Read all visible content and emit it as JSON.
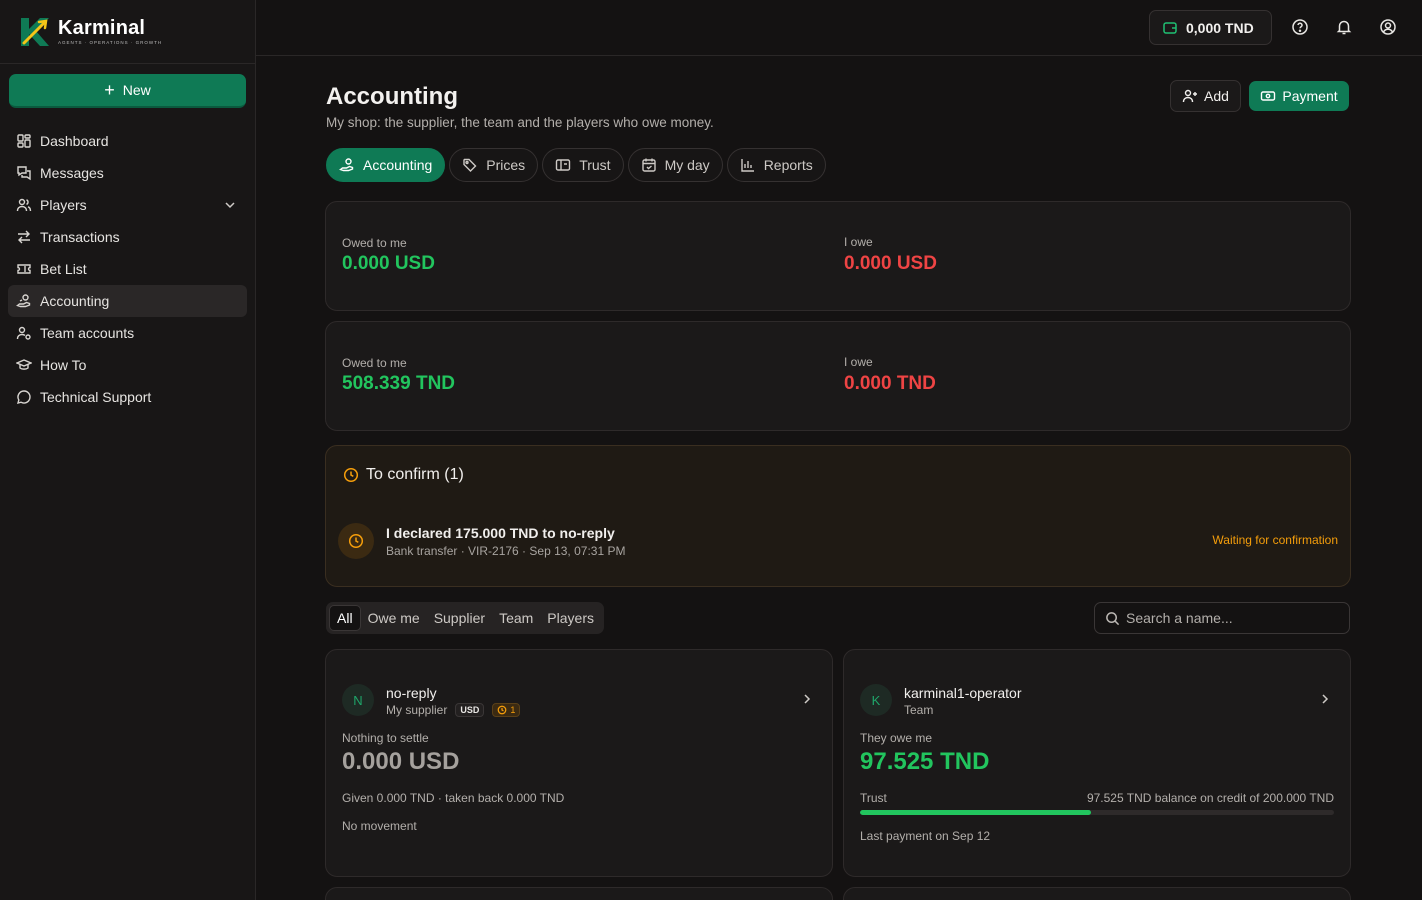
{
  "brand": {
    "name": "Karminal",
    "tagline": "AGENTS · OPERATIONS · GROWTH"
  },
  "sidebar": {
    "new_label": "New",
    "items": [
      {
        "label": "Dashboard",
        "icon": "dashboard-icon"
      },
      {
        "label": "Messages",
        "icon": "messages-icon"
      },
      {
        "label": "Players",
        "icon": "players-icon"
      },
      {
        "label": "Transactions",
        "icon": "transactions-icon"
      },
      {
        "label": "Bet List",
        "icon": "ticket-icon"
      },
      {
        "label": "Accounting",
        "icon": "accounting-icon",
        "active": true
      },
      {
        "label": "Team accounts",
        "icon": "team-icon"
      },
      {
        "label": "How To",
        "icon": "graduation-cap-icon"
      },
      {
        "label": "Technical Support",
        "icon": "chat-bubble-icon"
      }
    ]
  },
  "topbar": {
    "balance": "0,000 TND"
  },
  "header": {
    "title": "Accounting",
    "subtitle": "My shop: the supplier, the team and the players who owe money.",
    "add_label": "Add",
    "payment_label": "Payment"
  },
  "tabs": [
    {
      "label": "Accounting",
      "active": true
    },
    {
      "label": "Prices"
    },
    {
      "label": "Trust"
    },
    {
      "label": "My day"
    },
    {
      "label": "Reports"
    }
  ],
  "summary": [
    {
      "owed_label": "Owed to me",
      "owed_value": "0.000 USD",
      "owe_label": "I owe",
      "owe_value": "0.000 USD"
    },
    {
      "owed_label": "Owed to me",
      "owed_value": "508.339 TND",
      "owe_label": "I owe",
      "owe_value": "0.000 TND"
    }
  ],
  "confirm": {
    "title": "To confirm (1)",
    "item": {
      "text": "I declared 175.000 TND to no-reply",
      "meta": "Bank transfer · VIR-2176 · Sep 13, 07:31 PM",
      "status": "Waiting for confirmation"
    }
  },
  "filter": {
    "chips": [
      "All",
      "Owe me",
      "Supplier",
      "Team",
      "Players"
    ],
    "active": "All"
  },
  "search": {
    "placeholder": "Search a name..."
  },
  "entities": [
    {
      "initial": "N",
      "name": "no-reply",
      "role": "My supplier",
      "badge": "USD",
      "pending": "1",
      "label": "Nothing to settle",
      "amount": "0.000 USD",
      "line1": "Given 0.000 TND · taken back 0.000 TND",
      "line2": "No movement"
    },
    {
      "initial": "K",
      "name": "karminal1-operator",
      "role": "Team",
      "label": "They owe me",
      "amount": "97.525 TND",
      "trust_label": "Trust",
      "trust_detail": "97.525 TND balance on credit of 200.000 TND",
      "trust_fraction": 0.4876,
      "line2": "Last payment on Sep 12"
    }
  ]
}
